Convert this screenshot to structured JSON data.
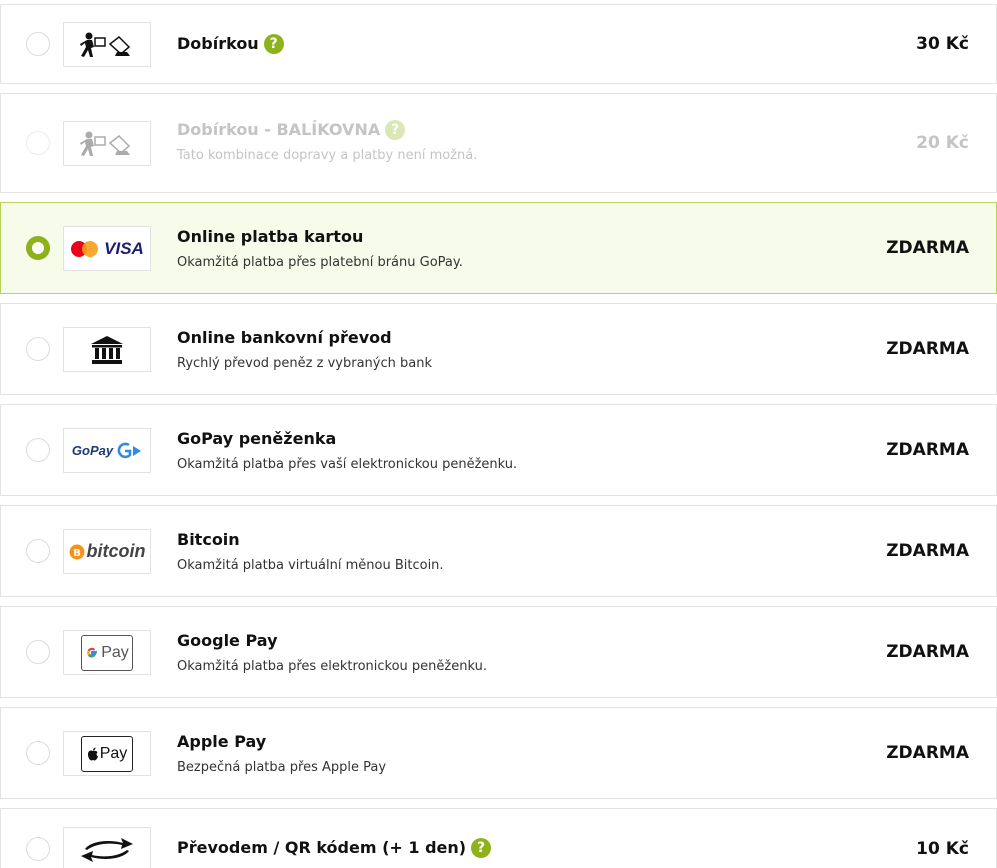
{
  "options": [
    {
      "title": "Dobírkou",
      "desc": "",
      "price": "30 Kč",
      "help": "?",
      "logo": "cod-courier-icon",
      "state": "default"
    },
    {
      "title": "Dobírkou - BALÍKOVNA",
      "desc": "Tato kombinace dopravy a platby není možná.",
      "price": "20 Kč",
      "help": "?",
      "logo": "cod-courier-icon",
      "state": "disabled"
    },
    {
      "title": "Online platba kartou",
      "desc": "Okamžitá platba přes platební bránu GoPay.",
      "price": "ZDARMA",
      "logo": "mastercard-visa-icon",
      "logo_text": "VISA",
      "state": "selected"
    },
    {
      "title": "Online bankovní převod",
      "desc": "Rychlý převod peněz z vybraných bank",
      "price": "ZDARMA",
      "logo": "bank-icon",
      "state": "default"
    },
    {
      "title": "GoPay peněženka",
      "desc": "Okamžitá platba přes vaší elektronickou peněženku.",
      "price": "ZDARMA",
      "logo": "gopay-logo-icon",
      "logo_text": "GoPay",
      "state": "default"
    },
    {
      "title": "Bitcoin",
      "desc": "Okamžitá platba virtuální měnou Bitcoin.",
      "price": "ZDARMA",
      "logo": "bitcoin-logo-icon",
      "logo_text": "bitcoin",
      "state": "default"
    },
    {
      "title": "Google Pay",
      "desc": "Okamžitá platba přes elektronickou peněženku.",
      "price": "ZDARMA",
      "logo": "google-pay-icon",
      "logo_text": "Pay",
      "state": "default"
    },
    {
      "title": "Apple Pay",
      "desc": "Bezpečná platba přes Apple Pay",
      "price": "ZDARMA",
      "logo": "apple-pay-icon",
      "logo_text": "Pay",
      "state": "default"
    },
    {
      "title": "Převodem / QR kódem (+ 1 den)",
      "desc": "",
      "price": "10 Kč",
      "help": "?",
      "logo": "transfer-arrows-icon",
      "state": "default"
    }
  ],
  "colors": {
    "accent": "#8fb21c",
    "selected_bg": "#f7fbe9",
    "selected_border": "#b7d35a"
  }
}
